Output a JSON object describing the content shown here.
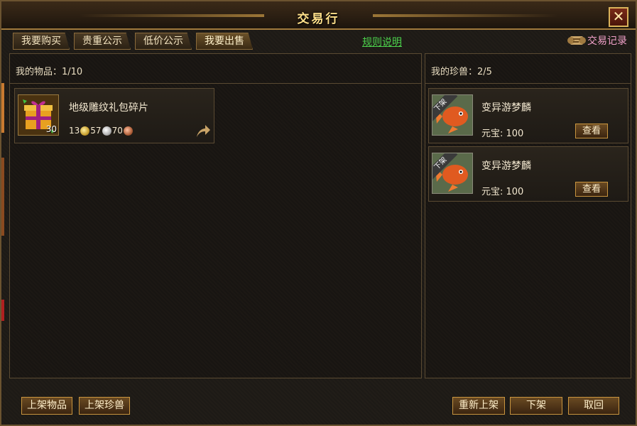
{
  "window": {
    "title": "交易行"
  },
  "tabs": [
    {
      "label": "我要购买"
    },
    {
      "label": "贵重公示"
    },
    {
      "label": "低价公示"
    },
    {
      "label": "我要出售"
    }
  ],
  "rules_link": "规则说明",
  "trade_record": "交易记录",
  "left_panel": {
    "header": "我的物品：1/10",
    "items": [
      {
        "name": "地级雕纹礼包碎片",
        "count": "30",
        "price": {
          "gold": "13",
          "silver": "57",
          "copper": "70"
        },
        "icon": "gift-box-icon"
      }
    ]
  },
  "right_panel": {
    "header": "我的珍兽：2/5",
    "pets": [
      {
        "name": "变异游梦麟",
        "ribbon": "下架",
        "price": "元宝:  100",
        "view": "查看",
        "icon": "fish-pet-icon"
      },
      {
        "name": "变异游梦麟",
        "ribbon": "下架",
        "price": "元宝:  100",
        "view": "查看",
        "icon": "fish-pet-icon"
      }
    ]
  },
  "bottom_buttons": {
    "list_item": "上架物品",
    "list_pet": "上架珍兽",
    "relist": "重新上架",
    "delist": "下架",
    "cancel": "取回"
  },
  "close_symbol": "✕",
  "colors": {
    "accent_gold": "#ffe08a",
    "link_green": "#4cd24c",
    "record_pink": "#f0a0c8"
  }
}
